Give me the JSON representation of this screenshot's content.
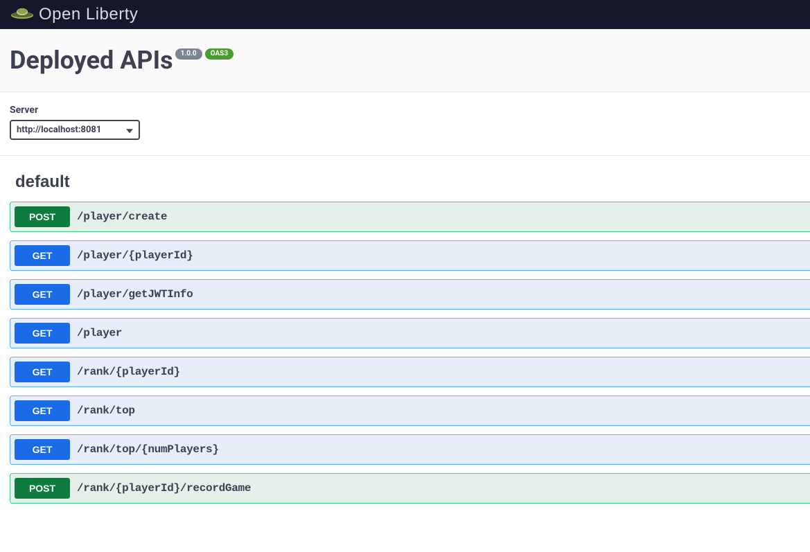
{
  "header": {
    "brand": "Open Liberty"
  },
  "title": "Deployed APIs",
  "badges": {
    "version": "1.0.0",
    "oas": "OAS3"
  },
  "server": {
    "label": "Server",
    "selected": "http://localhost:8081"
  },
  "tag": "default",
  "operations": [
    {
      "method": "POST",
      "path": "/player/create"
    },
    {
      "method": "GET",
      "path": "/player/{playerId}"
    },
    {
      "method": "GET",
      "path": "/player/getJWTInfo"
    },
    {
      "method": "GET",
      "path": "/player"
    },
    {
      "method": "GET",
      "path": "/rank/{playerId}"
    },
    {
      "method": "GET",
      "path": "/rank/top"
    },
    {
      "method": "GET",
      "path": "/rank/top/{numPlayers}"
    },
    {
      "method": "POST",
      "path": "/rank/{playerId}/recordGame"
    }
  ]
}
